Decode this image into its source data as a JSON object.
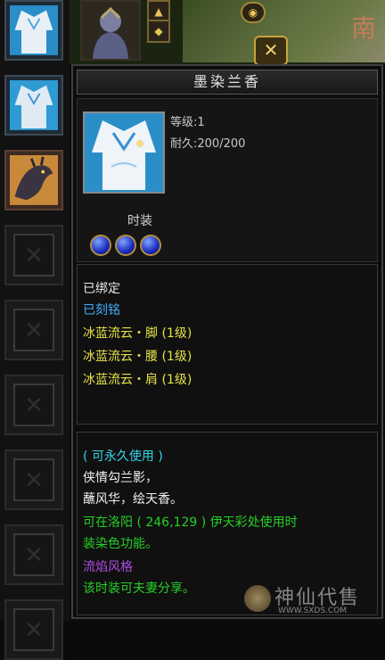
{
  "tooltip": {
    "title": "墨染兰香",
    "level_label": "等级:1",
    "durability_label": "耐久:200/200",
    "item_type": "时装",
    "gem_count": 3,
    "status": {
      "bound": "已绑定",
      "engraved": "已刻铭"
    },
    "set_attributes": [
      "冰蓝流云・脚 (1级)",
      "冰蓝流云・腰 (1级)",
      "冰蓝流云・肩 (1级)"
    ],
    "usage": "( 可永久使用 )",
    "flavor_lines": [
      "侠情勾兰影，",
      "蘸风华，绘天香。"
    ],
    "dye_info_lines": [
      "可在洛阳 ( 246,129 ) 伊天彩处使用时",
      "装染色功能。"
    ],
    "style_label": "流焰风格",
    "share_note": "该时装可夫妻分享。"
  },
  "map": {
    "region_char": "南"
  },
  "watermark": {
    "text": "神仙代售",
    "url": "WWW.SXDS.COM"
  },
  "colors": {
    "white_text": "#e8e8e8",
    "bound_text": "#e8e8e8",
    "engraved_text": "#3fb0ff",
    "set_text": "#e6e24a",
    "usage_text": "#35d6e8",
    "flavor_text": "#f0f0f0",
    "dye_text": "#25d025",
    "style_text": "#b04ce6",
    "share_text": "#25d025"
  }
}
